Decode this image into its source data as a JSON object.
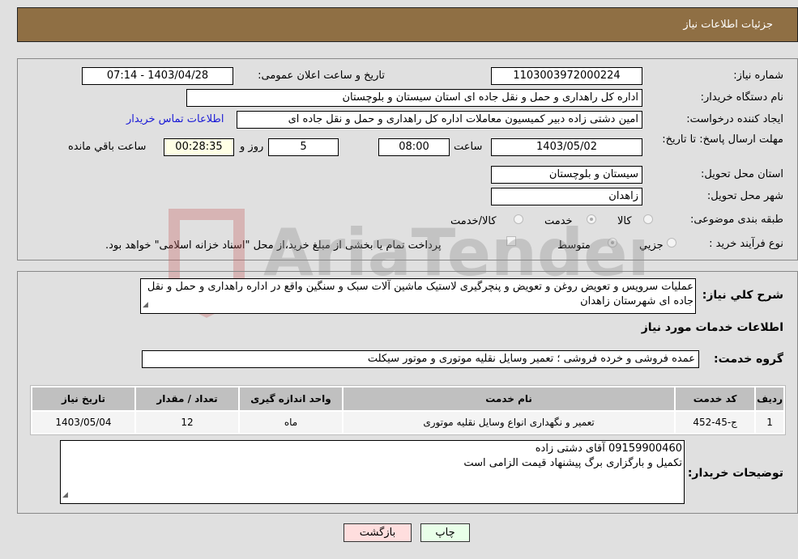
{
  "header": {
    "title": "جزئیات اطلاعات نیاز"
  },
  "fields": {
    "need_number_label": "شماره نیاز:",
    "need_number": "1103003972000224",
    "announce_label": "تاریخ و ساعت اعلان عمومی:",
    "announce_value": "1403/04/28 - 07:14",
    "buyer_org_label": "نام دستگاه خریدار:",
    "buyer_org": "اداره کل راهداری و حمل و نقل جاده ای استان سیستان و بلوچستان",
    "creator_label": "ایجاد کننده درخواست:",
    "creator": "امین دشتی زاده دبیر کمیسیون معاملات اداره کل راهداری و حمل و نقل جاده ای",
    "contact_link": "اطلاعات تماس خریدار",
    "deadline_label": "مهلت ارسال پاسخ: تا تاریخ:",
    "deadline_date": "1403/05/02",
    "time_label": "ساعت",
    "deadline_time": "08:00",
    "days_value": "5",
    "days_label": "روز و",
    "remaining_time": "00:28:35",
    "remaining_label": "ساعت باقي مانده",
    "province_label": "استان محل تحویل:",
    "province": "سیستان و بلوچستان",
    "city_label": "شهر محل تحویل:",
    "city": "زاهدان",
    "category_label": "طبقه بندی موضوعی:",
    "category_options": [
      "کالا",
      "خدمت",
      "کالا/خدمت"
    ],
    "category_selected": "خدمت",
    "process_label": "نوع فرآیند خرید :",
    "process_options": [
      "جزيي",
      "متوسط"
    ],
    "process_selected": "متوسط",
    "treasury_note": "پرداخت تمام یا بخشی از مبلغ خرید،از محل \"اسناد خزانه اسلامی\" خواهد بود."
  },
  "description": {
    "label": "شرح کلي نياز:",
    "text": "عملیات سرویس و تعویض روغن و تعویض و پنچرگیری لاستیک ماشین آلات سبک و سنگین واقع در اداره راهداری و حمل و نقل جاده ای شهرستان زاهدان"
  },
  "services": {
    "section_title": "اطلاعات خدمات مورد نياز",
    "group_label": "گروه خدمت:",
    "group_value": "عمده فروشی و خرده فروشی ؛ تعمیر وسایل نقلیه موتوری و موتور سیکلت",
    "table": {
      "headers": [
        "رديف",
        "کد خدمت",
        "نام خدمت",
        "واحد اندازه گيری",
        "تعداد / مقدار",
        "تاريخ نياز"
      ],
      "rows": [
        [
          "1",
          "ج-45-452",
          "تعمیر و نگهداری انواع وسایل نقلیه موتوری",
          "ماه",
          "12",
          "1403/05/04"
        ]
      ]
    }
  },
  "buyer_notes": {
    "label": "توضیحات خریدار:",
    "lines": [
      "09159900460 آقای دشتی زاده",
      "تکمیل و بارگزاری برگ پیشنهاد قیمت الزامی است"
    ]
  },
  "buttons": {
    "print": "چاپ",
    "back": "بازگشت"
  },
  "colors": {
    "header_bg": "#8f6f44",
    "print_bg": "#e9ffe9",
    "back_bg": "#ffdede",
    "link": "#1a1ad6"
  },
  "watermark": "AriaTender.neT"
}
